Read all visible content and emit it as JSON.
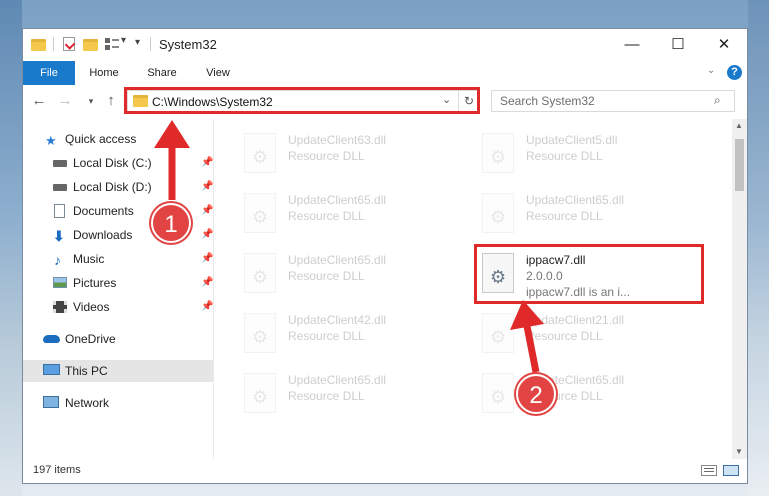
{
  "window": {
    "title": "System32",
    "controls": {
      "minimize": "—",
      "maximize": "☐",
      "close": "✕"
    }
  },
  "ribbon": {
    "tabs": [
      "File",
      "Home",
      "Share",
      "View"
    ],
    "help": "?"
  },
  "nav": {
    "address": "C:\\Windows\\System32",
    "search_placeholder": "Search System32"
  },
  "sidebar": {
    "items": [
      {
        "label": "Quick access",
        "icon": "star-icon"
      },
      {
        "label": "Local Disk (C:)",
        "icon": "drive-icon",
        "pinned": true
      },
      {
        "label": "Local Disk (D:)",
        "icon": "drive-icon",
        "pinned": true
      },
      {
        "label": "Documents",
        "icon": "documents-icon",
        "pinned": true
      },
      {
        "label": "Downloads",
        "icon": "downloads-icon",
        "pinned": true
      },
      {
        "label": "Music",
        "icon": "music-icon",
        "pinned": true
      },
      {
        "label": "Pictures",
        "icon": "pictures-icon",
        "pinned": true
      },
      {
        "label": "Videos",
        "icon": "videos-icon",
        "pinned": true
      },
      {
        "label": "OneDrive",
        "icon": "onedrive-icon"
      },
      {
        "label": "This PC",
        "icon": "computer-icon",
        "selected": true
      },
      {
        "label": "Network",
        "icon": "network-icon"
      }
    ]
  },
  "files": [
    {
      "name": "UpdateClient63.dll",
      "line1": "Resource DLL",
      "line2": ""
    },
    {
      "name": "UpdateClient5.dll",
      "line1": "Resource DLL",
      "line2": ""
    },
    {
      "name": "UpdateClient65.dll",
      "line1": "Resource DLL",
      "line2": ""
    },
    {
      "name": "UpdateClient65.dll",
      "line1": "Resource DLL",
      "line2": ""
    },
    {
      "name": "UpdateClient65.dll",
      "line1": "Resource DLL",
      "line2": ""
    },
    {
      "name": "ippacw7.dll",
      "line1": "2.0.0.0",
      "line2": "ippacw7.dll is an i..."
    },
    {
      "name": "UpdateClient42.dll",
      "line1": "Resource DLL",
      "line2": ""
    },
    {
      "name": "UpdateClient21.dll",
      "line1": "Resource DLL",
      "line2": ""
    },
    {
      "name": "UpdateClient65.dll",
      "line1": "Resource DLL",
      "line2": ""
    },
    {
      "name": "UpdateClient65.dll",
      "line1": "Resource DLL",
      "line2": ""
    }
  ],
  "status": {
    "items_count": "197 items"
  },
  "annotations": {
    "step1": "1",
    "step2": "2",
    "color": "#e02a2a"
  }
}
